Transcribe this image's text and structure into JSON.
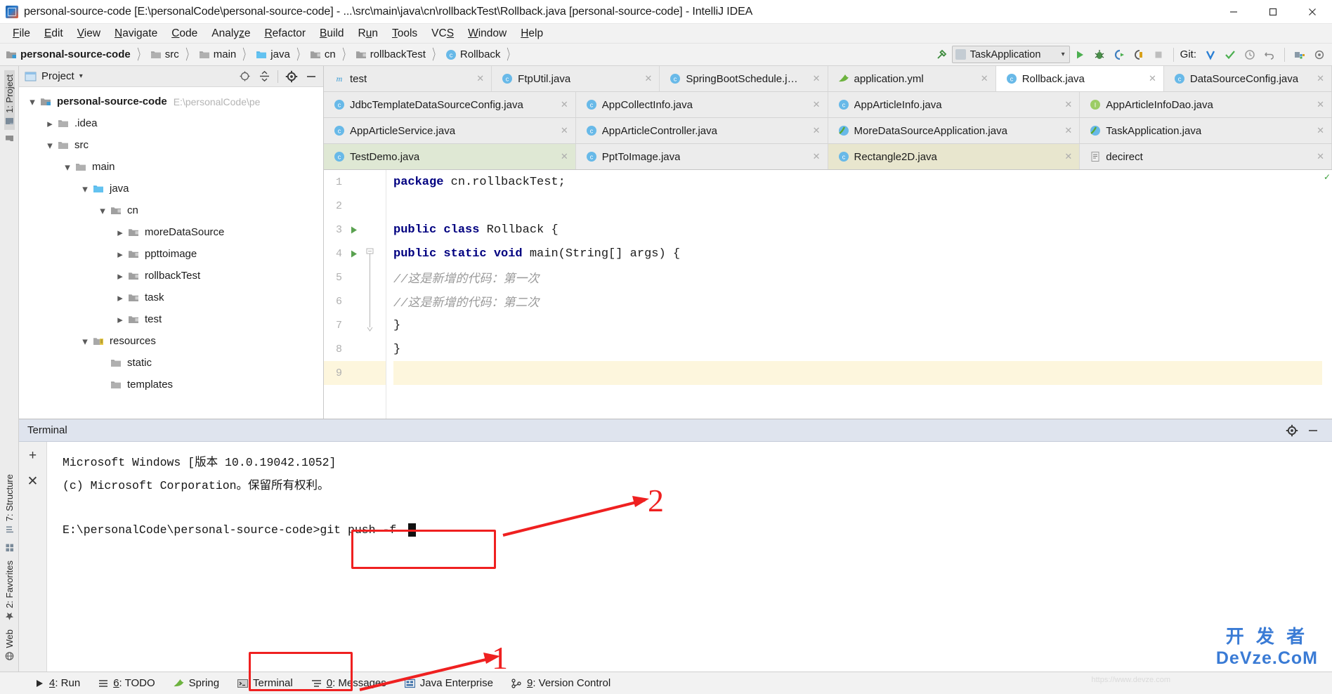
{
  "window": {
    "title": "personal-source-code [E:\\personalCode\\personal-source-code] - ...\\src\\main\\java\\cn\\rollbackTest\\Rollback.java [personal-source-code] - IntelliJ IDEA",
    "app_icon": "intellij-idea-icon",
    "minimize_label": "minimize-icon",
    "maximize_label": "maximize-icon",
    "close_label": "close-icon"
  },
  "menu": {
    "items": [
      {
        "label": "File",
        "mnemonic": "F"
      },
      {
        "label": "Edit",
        "mnemonic": "E"
      },
      {
        "label": "View",
        "mnemonic": "V"
      },
      {
        "label": "Navigate",
        "mnemonic": "N"
      },
      {
        "label": "Code",
        "mnemonic": "C"
      },
      {
        "label": "Analyze",
        "mnemonic": "z"
      },
      {
        "label": "Refactor",
        "mnemonic": "R"
      },
      {
        "label": "Build",
        "mnemonic": "B"
      },
      {
        "label": "Run",
        "mnemonic": "u"
      },
      {
        "label": "Tools",
        "mnemonic": "T"
      },
      {
        "label": "VCS",
        "mnemonic": "S"
      },
      {
        "label": "Window",
        "mnemonic": "W"
      },
      {
        "label": "Help",
        "mnemonic": "H"
      }
    ]
  },
  "breadcrumb": {
    "items": [
      {
        "label": "personal-source-code",
        "icon": "module-folder-icon",
        "bold": true
      },
      {
        "label": "src",
        "icon": "folder-icon",
        "bold": false
      },
      {
        "label": "main",
        "icon": "folder-icon",
        "bold": false
      },
      {
        "label": "java",
        "icon": "source-folder-icon",
        "bold": false
      },
      {
        "label": "cn",
        "icon": "package-icon",
        "bold": false
      },
      {
        "label": "rollbackTest",
        "icon": "package-icon",
        "bold": false
      },
      {
        "label": "Rollback",
        "icon": "java-class-icon",
        "bold": false
      }
    ]
  },
  "toolbar": {
    "build_icon": "hammer-icon",
    "run_config": {
      "label": "TaskApplication",
      "icon": "run-config-icon",
      "dropdown": "chevron-down-icon"
    },
    "run_icon": "run-icon",
    "debug_icon": "debug-icon",
    "run_coverage_icon": "run-with-coverage-icon",
    "profile_icon": "profile-icon",
    "stop_icon": "stop-icon",
    "git_label": "Git:",
    "git_update_icon": "update-project-icon",
    "git_commit_icon": "commit-icon",
    "git_history_icon": "history-icon",
    "git_rollback_icon": "rollback-icon",
    "structure_icon": "project-structure-icon",
    "settings_icon": "settings-icon"
  },
  "left_strip": {
    "top_items": [
      {
        "label": "1: Project",
        "icon": "project-icon",
        "selected": true
      },
      {
        "label": "",
        "icon": "folder-icon",
        "selected": false
      }
    ],
    "bottom_items": [
      {
        "label": "7: Structure",
        "icon": "structure-icon"
      },
      {
        "label": "",
        "icon": "grid-icon"
      },
      {
        "label": "2: Favorites",
        "icon": "star-icon"
      },
      {
        "label": "Web",
        "icon": "globe-icon"
      }
    ]
  },
  "project_panel": {
    "title": "Project",
    "dropdown_icon": "chevron-down-icon",
    "locate_icon": "target-icon",
    "collapse_icon": "collapse-all-icon",
    "settings_icon": "gear-icon",
    "hide_icon": "hide-icon",
    "tree": [
      {
        "label": "personal-source-code",
        "path": "E:\\personalCode\\pe",
        "depth": 0,
        "twisty": "expanded",
        "icon": "module-icon",
        "bold": true
      },
      {
        "label": ".idea",
        "path": "",
        "depth": 1,
        "twisty": "collapsed",
        "icon": "folder-icon",
        "bold": false
      },
      {
        "label": "src",
        "path": "",
        "depth": 1,
        "twisty": "expanded",
        "icon": "folder-icon",
        "bold": false
      },
      {
        "label": "main",
        "path": "",
        "depth": 2,
        "twisty": "expanded",
        "icon": "folder-icon",
        "bold": false
      },
      {
        "label": "java",
        "path": "",
        "depth": 3,
        "twisty": "expanded",
        "icon": "source-folder-icon",
        "bold": false
      },
      {
        "label": "cn",
        "path": "",
        "depth": 4,
        "twisty": "expanded",
        "icon": "package-icon",
        "bold": false
      },
      {
        "label": "moreDataSource",
        "path": "",
        "depth": 5,
        "twisty": "collapsed",
        "icon": "package-icon",
        "bold": false
      },
      {
        "label": "ppttoimage",
        "path": "",
        "depth": 5,
        "twisty": "collapsed",
        "icon": "package-icon",
        "bold": false
      },
      {
        "label": "rollbackTest",
        "path": "",
        "depth": 5,
        "twisty": "collapsed",
        "icon": "package-icon",
        "bold": false
      },
      {
        "label": "task",
        "path": "",
        "depth": 5,
        "twisty": "collapsed",
        "icon": "package-icon",
        "bold": false
      },
      {
        "label": "test",
        "path": "",
        "depth": 5,
        "twisty": "collapsed",
        "icon": "package-icon",
        "bold": false
      },
      {
        "label": "resources",
        "path": "",
        "depth": 3,
        "twisty": "expanded",
        "icon": "resources-folder-icon",
        "bold": false
      },
      {
        "label": "static",
        "path": "",
        "depth": 4,
        "twisty": "none",
        "icon": "folder-icon",
        "bold": false
      },
      {
        "label": "templates",
        "path": "",
        "depth": 4,
        "twisty": "none",
        "icon": "folder-icon",
        "bold": false
      }
    ]
  },
  "editor": {
    "tab_rows": [
      [
        {
          "label": "test",
          "icon": "maven-icon",
          "state": "normal",
          "close": "close-icon"
        },
        {
          "label": "FtpUtil.java",
          "icon": "java-class-icon",
          "state": "normal",
          "close": "close-icon"
        },
        {
          "label": "SpringBootSchedule.java",
          "icon": "java-class-icon",
          "state": "normal",
          "close": "close-icon"
        },
        {
          "label": "application.yml",
          "icon": "spring-yaml-icon",
          "state": "normal",
          "close": "close-icon"
        },
        {
          "label": "Rollback.java",
          "icon": "java-class-icon",
          "state": "active",
          "close": "close-icon"
        },
        {
          "label": "DataSourceConfig.java",
          "icon": "java-class-icon",
          "state": "normal",
          "close": "close-icon"
        }
      ],
      [
        {
          "label": "JdbcTemplateDataSourceConfig.java",
          "icon": "java-class-icon",
          "state": "normal",
          "close": "close-icon"
        },
        {
          "label": "AppCollectInfo.java",
          "icon": "java-class-icon",
          "state": "normal",
          "close": "close-icon"
        },
        {
          "label": "AppArticleInfo.java",
          "icon": "java-class-icon",
          "state": "normal",
          "close": "close-icon"
        },
        {
          "label": "AppArticleInfoDao.java",
          "icon": "java-interface-icon",
          "state": "normal",
          "close": "close-icon"
        }
      ],
      [
        {
          "label": "AppArticleService.java",
          "icon": "java-class-icon",
          "state": "normal",
          "close": "close-icon"
        },
        {
          "label": "AppArticleController.java",
          "icon": "java-class-icon",
          "state": "normal",
          "close": "close-icon"
        },
        {
          "label": "MoreDataSourceApplication.java",
          "icon": "spring-class-icon",
          "state": "normal",
          "close": "close-icon"
        },
        {
          "label": "TaskApplication.java",
          "icon": "spring-class-icon",
          "state": "normal",
          "close": "close-icon"
        }
      ],
      [
        {
          "label": "TestDemo.java",
          "icon": "java-class-icon",
          "state": "green",
          "close": "close-icon"
        },
        {
          "label": "PptToImage.java",
          "icon": "java-class-icon",
          "state": "normal",
          "close": "close-icon"
        },
        {
          "label": "Rectangle2D.java",
          "icon": "java-class-icon",
          "state": "olive",
          "close": "close-icon"
        },
        {
          "label": "decirect",
          "icon": "text-file-icon",
          "state": "normal",
          "close": "close-icon"
        }
      ]
    ],
    "code_lines": [
      {
        "num": "1",
        "gutter_run": false,
        "fold": "",
        "segments": [
          {
            "t": "package",
            "c": "kw"
          },
          {
            "t": " cn.rollbackTest;",
            "c": ""
          }
        ],
        "indent": 0,
        "highlight": false
      },
      {
        "num": "2",
        "gutter_run": false,
        "fold": "",
        "segments": [],
        "indent": 0,
        "highlight": false
      },
      {
        "num": "3",
        "gutter_run": true,
        "fold": "",
        "segments": [
          {
            "t": "public class",
            "c": "kw"
          },
          {
            "t": " Rollback {",
            "c": ""
          }
        ],
        "indent": 0,
        "highlight": false
      },
      {
        "num": "4",
        "gutter_run": true,
        "fold": "top",
        "segments": [
          {
            "t": "public static void",
            "c": "kw"
          },
          {
            "t": " main(String[] args) {",
            "c": ""
          }
        ],
        "indent": 1,
        "highlight": false
      },
      {
        "num": "5",
        "gutter_run": false,
        "fold": "mid",
        "segments": [
          {
            "t": "//这是新增的代码：第一次",
            "c": "cmt"
          }
        ],
        "indent": 2,
        "highlight": false
      },
      {
        "num": "6",
        "gutter_run": false,
        "fold": "mid",
        "segments": [
          {
            "t": "//这是新增的代码：第二次",
            "c": "cmt"
          }
        ],
        "indent": 2,
        "highlight": false
      },
      {
        "num": "7",
        "gutter_run": false,
        "fold": "bottom",
        "segments": [
          {
            "t": "}",
            "c": ""
          }
        ],
        "indent": 1,
        "highlight": false
      },
      {
        "num": "8",
        "gutter_run": false,
        "fold": "",
        "segments": [
          {
            "t": "}",
            "c": ""
          }
        ],
        "indent": 0,
        "highlight": false
      },
      {
        "num": "9",
        "gutter_run": false,
        "fold": "",
        "segments": [],
        "indent": 0,
        "highlight": true
      }
    ],
    "inspection_status": "ok-check-icon"
  },
  "terminal": {
    "title": "Terminal",
    "settings_icon": "gear-icon",
    "hide_icon": "hide-icon",
    "new_session_icon": "plus-icon",
    "close_session_icon": "close-icon",
    "lines": [
      "Microsoft Windows [版本 10.0.19042.1052]",
      "(c) Microsoft Corporation。保留所有权利。",
      "",
      "E:\\personalCode\\personal-source-code>git push -f "
    ],
    "cursor": "block-caret"
  },
  "statusbar": {
    "items": [
      {
        "label": "4: Run",
        "mnemonic": "4",
        "icon": "run-icon"
      },
      {
        "label": "6: TODO",
        "mnemonic": "6",
        "icon": "todo-icon"
      },
      {
        "label": "Spring",
        "mnemonic": "",
        "icon": "spring-icon"
      },
      {
        "label": "Terminal",
        "mnemonic": "",
        "icon": "terminal-icon",
        "highlighted": true
      },
      {
        "label": "0: Messages",
        "mnemonic": "0",
        "icon": "messages-icon"
      },
      {
        "label": "Java Enterprise",
        "mnemonic": "",
        "icon": "java-ee-icon"
      },
      {
        "label": "9: Version Control",
        "mnemonic": "9",
        "icon": "version-control-icon"
      }
    ]
  },
  "annotations": [
    {
      "id": "1",
      "label": "1",
      "target": "terminal-status-button"
    },
    {
      "id": "2",
      "label": "2",
      "target": "git-push-command"
    }
  ],
  "watermark": {
    "line1": "开 发 者",
    "line2": "DeVze.CoM",
    "sub": "https://www.devze.com",
    "color": "#3a7bd5"
  },
  "colors": {
    "accent_red": "#ef2020",
    "tab_active_bg": "#ffffff",
    "tab_green_bg": "#dfe8d4",
    "tab_olive_bg": "#e8e6ce",
    "terminal_header_bg": "#dfe4ee",
    "keyword": "#000080",
    "comment": "#9a9a9a",
    "highlight_line": "#fdf6dd"
  }
}
